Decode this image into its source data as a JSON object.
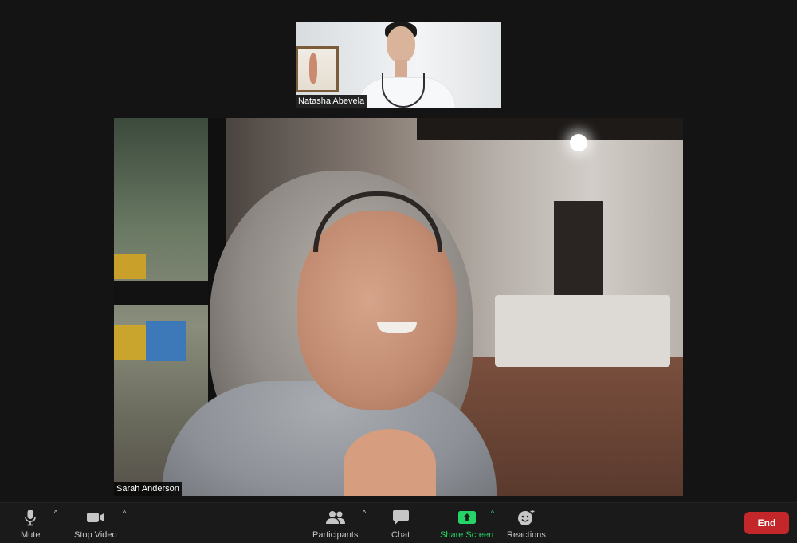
{
  "participants": {
    "thumbnail_name": "Natasha Abevela",
    "main_name": "Sarah Anderson"
  },
  "toolbar": {
    "mute_label": "Mute",
    "stop_video_label": "Stop Video",
    "participants_label": "Participants",
    "chat_label": "Chat",
    "share_screen_label": "Share Screen",
    "reactions_label": "Reactions",
    "end_label": "End",
    "caret_glyph": "^"
  },
  "icons": {
    "mute": "microphone-icon",
    "stop_video": "video-camera-icon",
    "participants": "participants-icon",
    "chat": "chat-bubble-icon",
    "share_screen": "share-screen-icon",
    "reactions": "emoji-icon"
  },
  "colors": {
    "background": "#141414",
    "toolbar": "#1a1a1a",
    "share_green": "#25d366",
    "end_red": "#c4272a"
  }
}
